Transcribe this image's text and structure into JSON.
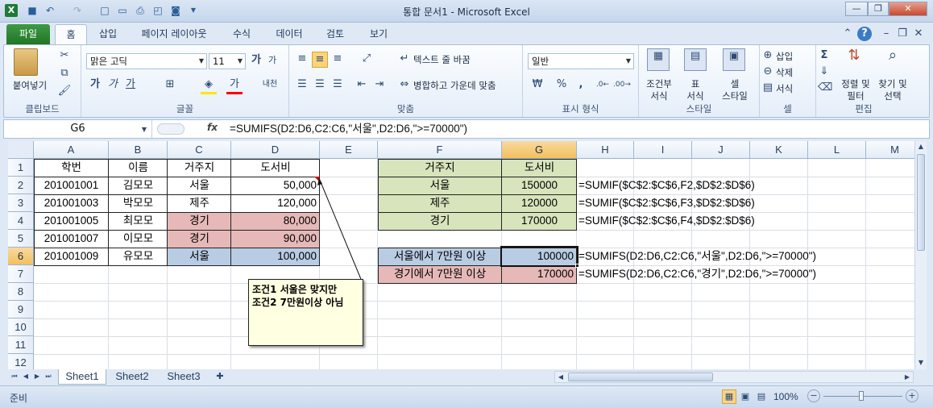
{
  "window": {
    "title": "통합 문서1 - Microsoft Excel"
  },
  "tabs": [
    "파일",
    "홈",
    "삽입",
    "페이지 레이아웃",
    "수식",
    "데이터",
    "검토",
    "보기"
  ],
  "ribbon": {
    "clipboard": {
      "paste": "붙여넣기",
      "label": "클립보드"
    },
    "font": {
      "name": "맑은 고딕",
      "size": "11",
      "label": "글꼴",
      "grow": "가",
      "shrink": "가",
      "bold": "가",
      "italic": "가",
      "underline": "가",
      "fontcolor": "가",
      "phonetic": "내천"
    },
    "align": {
      "wrap": "텍스트 줄 바꿈",
      "merge": "병합하고 가운데 맞춤",
      "label": "맞춤"
    },
    "number": {
      "format": "일반",
      "label": "표시 형식",
      "percent": "%",
      "comma": ","
    },
    "styles": {
      "cond1": "조건부",
      "cond2": "서식",
      "table1": "표",
      "table2": "서식",
      "cell1": "셀",
      "cell2": "스타일",
      "label": "스타일"
    },
    "cells": {
      "insert": "삽입",
      "delete": "삭제",
      "format": "서식",
      "label": "셀"
    },
    "editing": {
      "sort1": "정렬 및",
      "sort2": "필터",
      "find1": "찾기 및",
      "find2": "선택",
      "label": "편집",
      "sigma": "Σ"
    }
  },
  "formula_bar": {
    "name_box": "G6",
    "fx": "fx",
    "formula": "=SUMIFS(D2:D6,C2:C6,\"서울\",D2:D6,\">=70000\")"
  },
  "columns": [
    "A",
    "B",
    "C",
    "D",
    "E",
    "F",
    "G",
    "H",
    "I",
    "J",
    "K",
    "L",
    "M"
  ],
  "rows": [
    "1",
    "2",
    "3",
    "4",
    "5",
    "6",
    "7",
    "8",
    "9",
    "10",
    "11",
    "12"
  ],
  "table1": {
    "headers": [
      "학번",
      "이름",
      "거주지",
      "도서비"
    ],
    "rows": [
      [
        "201001001",
        "김모모",
        "서울",
        "50,000"
      ],
      [
        "201001003",
        "박모모",
        "제주",
        "120,000"
      ],
      [
        "201001005",
        "최모모",
        "경기",
        "80,000"
      ],
      [
        "201001007",
        "이모모",
        "경기",
        "90,000"
      ],
      [
        "201001009",
        "유모모",
        "서울",
        "100,000"
      ]
    ]
  },
  "table2": {
    "headers": [
      "거주지",
      "도서비"
    ],
    "rows": [
      [
        "서울",
        "150000"
      ],
      [
        "제주",
        "120000"
      ],
      [
        "경기",
        "170000"
      ]
    ],
    "formulas": [
      "=SUMIF($C$2:$C$6,F2,$D$2:$D$6)",
      "=SUMIF($C$2:$C$6,F3,$D$2:$D$6)",
      "=SUMIF($C$2:$C$6,F4,$D$2:$D$6)"
    ]
  },
  "table3": {
    "rows": [
      [
        "서울에서 7만원 이상",
        "100000"
      ],
      [
        "경기에서 7만원 이상",
        "170000"
      ]
    ],
    "formulas": [
      "=SUMIFS(D2:D6,C2:C6,\"서울\",D2:D6,\">=70000\")",
      "=SUMIFS(D2:D6,C2:C6,\"경기\",D2:D6,\">=70000\")"
    ]
  },
  "comment": {
    "line1": "조건1 서울은 맞지만",
    "line2": "조건2 7만원이상 아님"
  },
  "sheets": [
    "Sheet1",
    "Sheet2",
    "Sheet3"
  ],
  "status": {
    "mode": "준비",
    "zoom": "100%"
  },
  "colors": {
    "green_fill": "#d8e4bc",
    "pink_fill": "#e6b9b8",
    "blue_fill": "#b8cce4",
    "accent": "#217346"
  }
}
